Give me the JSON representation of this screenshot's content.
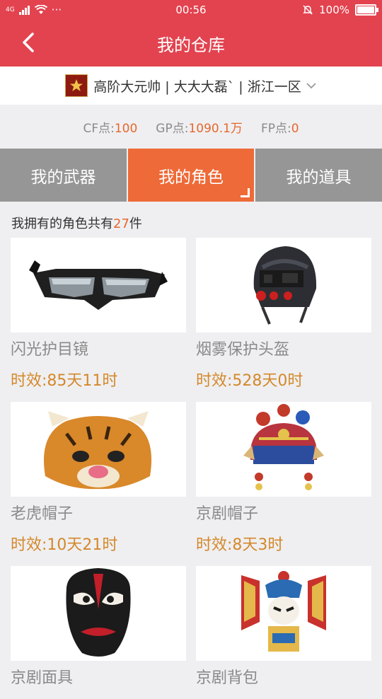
{
  "status": {
    "network": "4G",
    "time": "00:56",
    "battery": "100%"
  },
  "header": {
    "title": "我的仓库"
  },
  "account": {
    "text": "高阶大元帅 | 大大大磊` | 浙江一区"
  },
  "points": [
    {
      "label": "CF点:",
      "value": "100"
    },
    {
      "label": "GP点:",
      "value": "1090.1万"
    },
    {
      "label": "FP点:",
      "value": "0"
    }
  ],
  "tabs": [
    {
      "label": "我的武器"
    },
    {
      "label": "我的角色"
    },
    {
      "label": "我的道具"
    }
  ],
  "summary": {
    "prefix": "我拥有的角色共有",
    "count": "27",
    "suffix": "件"
  },
  "items": [
    {
      "name": "闪光护目镜",
      "time": "时效:85天11时",
      "icon": "goggles-icon"
    },
    {
      "name": "烟雾保护头盔",
      "time": "时效:528天0时",
      "icon": "helmet-icon"
    },
    {
      "name": "老虎帽子",
      "time": "时效:10天21时",
      "icon": "tiger-hat-icon"
    },
    {
      "name": "京剧帽子",
      "time": "时效:8天3时",
      "icon": "opera-hat-icon"
    },
    {
      "name": "京剧面具",
      "time": "",
      "icon": "opera-mask-icon"
    },
    {
      "name": "京剧背包",
      "time": "",
      "icon": "opera-backpack-icon"
    }
  ],
  "colors": {
    "header": "#e2434f",
    "accent": "#ee6a38",
    "tab_inactive": "#969696",
    "time_text": "#d4882a"
  }
}
